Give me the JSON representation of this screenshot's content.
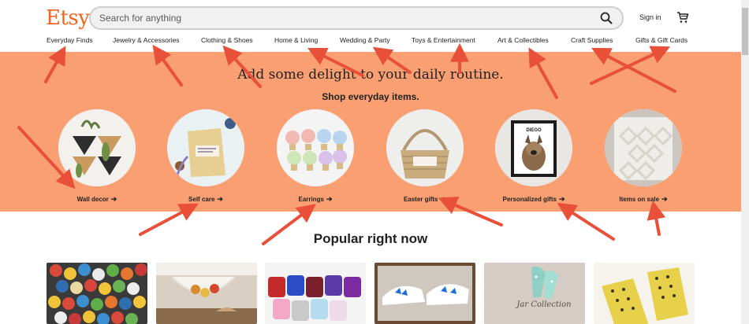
{
  "header": {
    "logo": "Etsy",
    "search_placeholder": "Search for anything",
    "signin_label": "Sign in"
  },
  "nav": {
    "items": [
      "Everyday Finds",
      "Jewelry & Accessories",
      "Clothing & Shoes",
      "Home & Living",
      "Wedding & Party",
      "Toys & Entertainment",
      "Art & Collectibles",
      "Craft Supplies",
      "Gifts & Gift Cards"
    ]
  },
  "hero": {
    "title": "Add some delight to your daily routine.",
    "subtitle": "Shop everyday items.",
    "categories": [
      {
        "label": "Wall decor"
      },
      {
        "label": "Self care"
      },
      {
        "label": "Earrings"
      },
      {
        "label": "Easter gifts"
      },
      {
        "label": "Personalized gifts",
        "image_text": "DIEGO"
      },
      {
        "label": "Items on sale"
      }
    ]
  },
  "popular": {
    "title": "Popular right now",
    "product_image_texts": [
      "Jar Collection"
    ]
  },
  "colors": {
    "brand": "#f1641e",
    "hero_bg": "#f99f72",
    "annotation_arrow": "#e8503a"
  },
  "icons": [
    "search-icon",
    "cart-icon",
    "arrow-right-icon",
    "annotation-arrow"
  ]
}
